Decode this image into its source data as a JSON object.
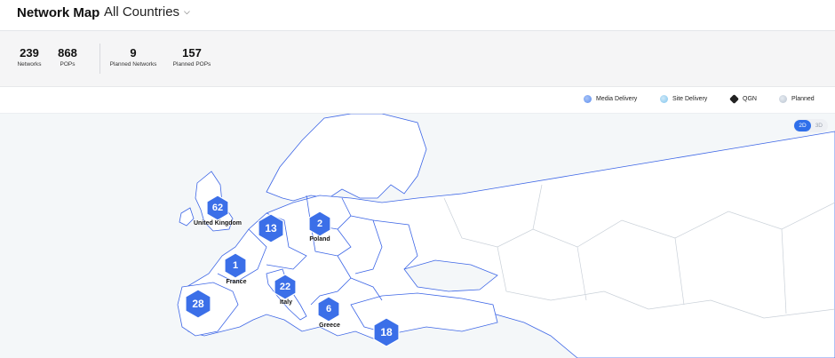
{
  "header": {
    "title": "Network Map",
    "country_selector": "All Countries"
  },
  "stats": [
    {
      "value": "239",
      "label": "Networks"
    },
    {
      "value": "868",
      "label": "POPs"
    },
    {
      "value": "9",
      "label": "Planned Networks"
    },
    {
      "value": "157",
      "label": "Planned POPs"
    }
  ],
  "legend": [
    {
      "label": "Media Delivery",
      "icon": "media-delivery-icon",
      "color": "#5b8def"
    },
    {
      "label": "Site Delivery",
      "icon": "site-delivery-icon",
      "color": "#7fc4ee"
    },
    {
      "label": "QGN",
      "icon": "qgn-icon",
      "color": "#222222"
    },
    {
      "label": "Planned",
      "icon": "planned-icon",
      "color": "#b9c3d0"
    }
  ],
  "view_toggle": {
    "options": [
      "2D",
      "3D"
    ],
    "active": "2D"
  },
  "colors": {
    "marker": "#3b6fe8",
    "border": "#3d66e6",
    "land": "#ffffff",
    "sea": "#f4f7f9"
  },
  "markers": [
    {
      "value": "62",
      "label": "United Kingdom"
    },
    {
      "value": "13",
      "label": ""
    },
    {
      "value": "2",
      "label": "Poland"
    },
    {
      "value": "1",
      "label": "France"
    },
    {
      "value": "22",
      "label": "Italy"
    },
    {
      "value": "28",
      "label": ""
    },
    {
      "value": "6",
      "label": "Greece"
    },
    {
      "value": "18",
      "label": ""
    }
  ]
}
